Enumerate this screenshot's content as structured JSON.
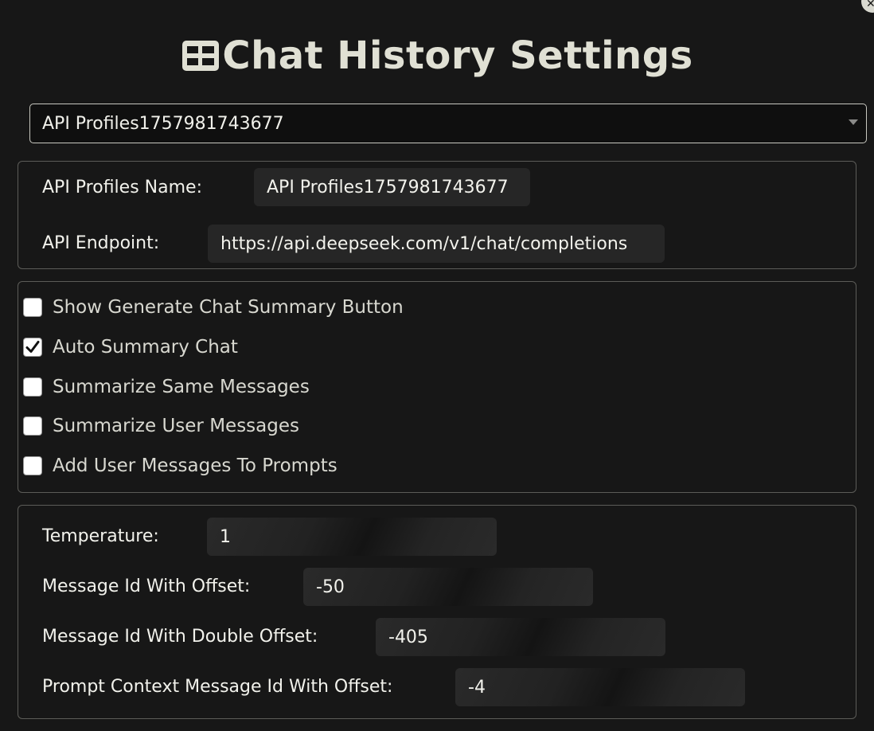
{
  "title": "Chat History Settings",
  "icons": {
    "title": "grid-table-icon",
    "corner": "close-badge-icon",
    "select": "chevron-down-icon",
    "check": "checkmark-icon"
  },
  "profile_select": {
    "selected": "API Profiles1757981743677"
  },
  "api": {
    "name_label": "API Profiles Name:",
    "name_value": "API Profiles1757981743677",
    "endpoint_label": "API Endpoint:",
    "endpoint_value": "https://api.deepseek.com/v1/chat/completions"
  },
  "options": [
    {
      "label": "Show Generate Chat Summary Button",
      "checked": false
    },
    {
      "label": "Auto Summary Chat",
      "checked": true
    },
    {
      "label": "Summarize Same Messages",
      "checked": false
    },
    {
      "label": "Summarize User Messages",
      "checked": false
    },
    {
      "label": "Add User Messages To Prompts",
      "checked": false
    }
  ],
  "params": {
    "temperature_label": "Temperature:",
    "temperature_value": "1",
    "offset_label": "Message Id With Offset:",
    "offset_value": "-50",
    "double_offset_label": "Message Id With Double Offset:",
    "double_offset_value": "-405",
    "prompt_offset_label": "Prompt Context Message Id With Offset:",
    "prompt_offset_value": "-4"
  }
}
